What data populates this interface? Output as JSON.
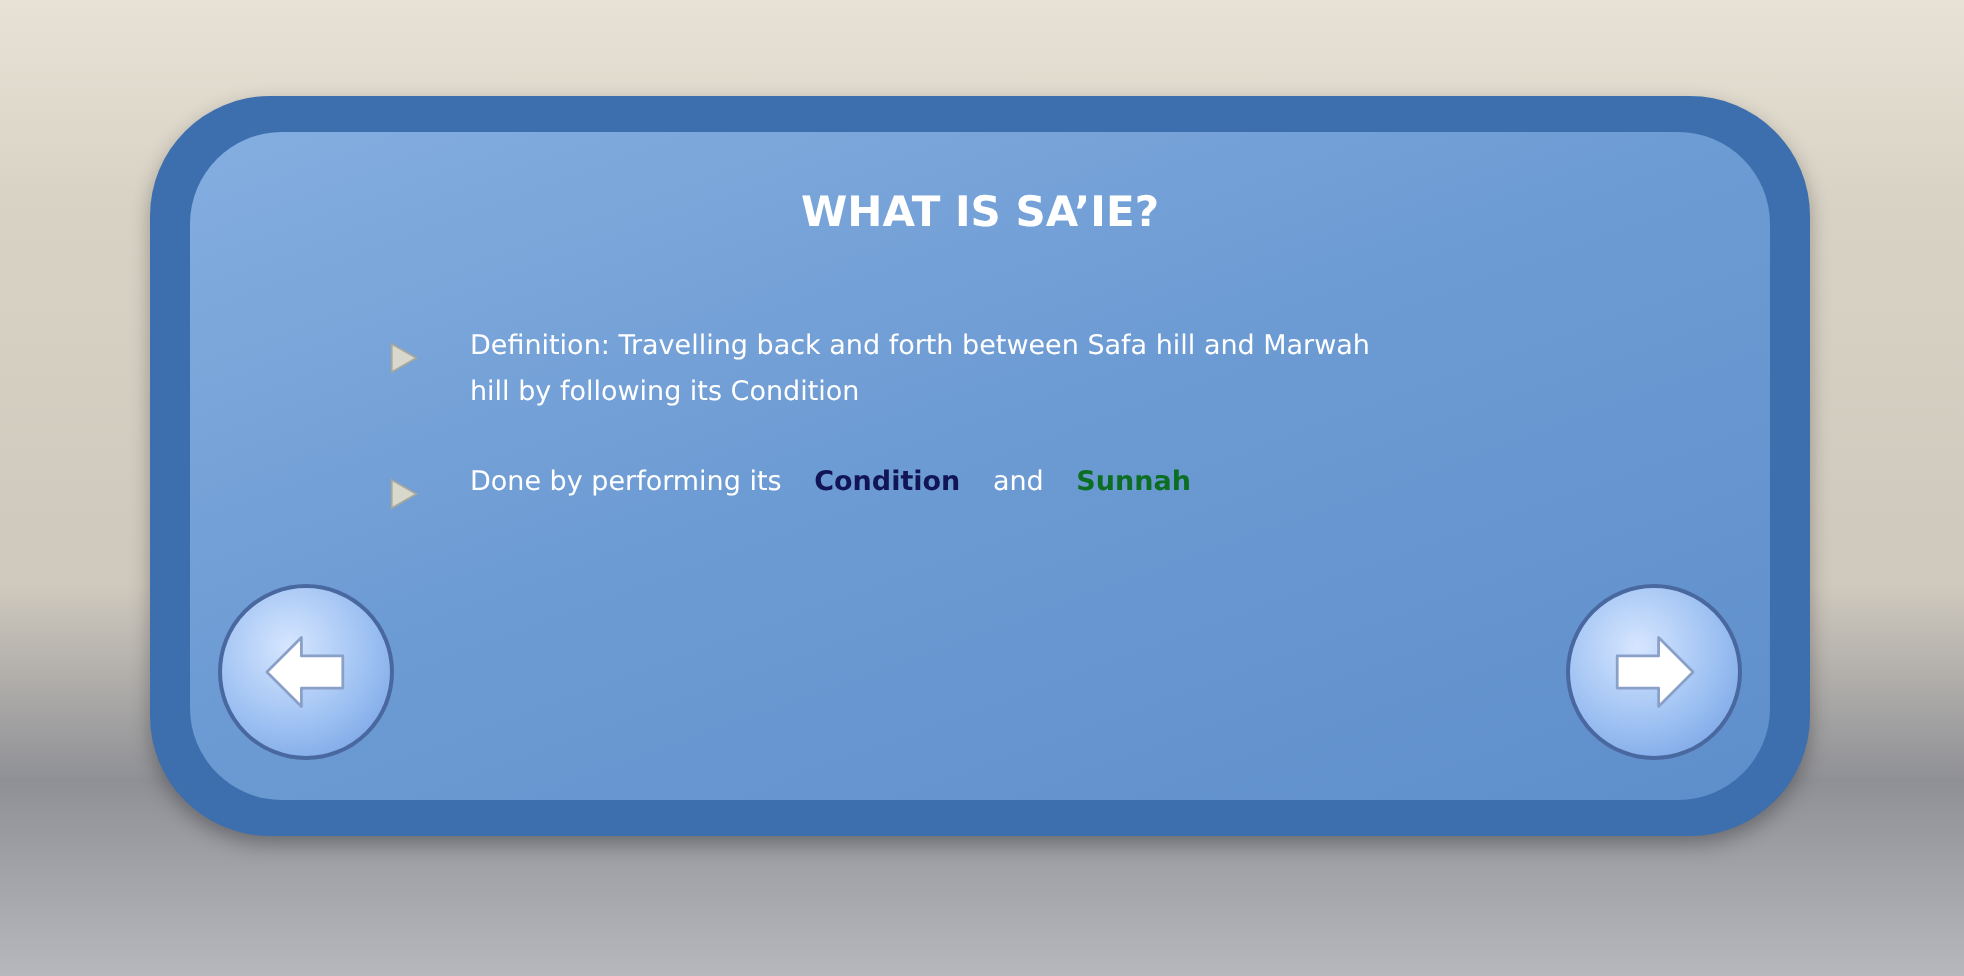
{
  "dialog": {
    "title": "WHAT IS SA’IE?",
    "bullets": [
      {
        "segments": [
          {
            "text": "Definition: Travelling back and forth between Safa hill and Marwah hill by following its Condition",
            "kind": "plain"
          }
        ]
      },
      {
        "segments": [
          {
            "text": "Done by performing its",
            "kind": "plain"
          },
          {
            "text": "Condition",
            "kind": "term",
            "color": "#111455"
          },
          {
            "text": "and",
            "kind": "plain"
          },
          {
            "text": "Sunnah",
            "kind": "term",
            "color": "#0c6e22"
          }
        ]
      }
    ]
  },
  "navigation": {
    "previous": {
      "kind": "left"
    },
    "next": {
      "kind": "right"
    }
  }
}
